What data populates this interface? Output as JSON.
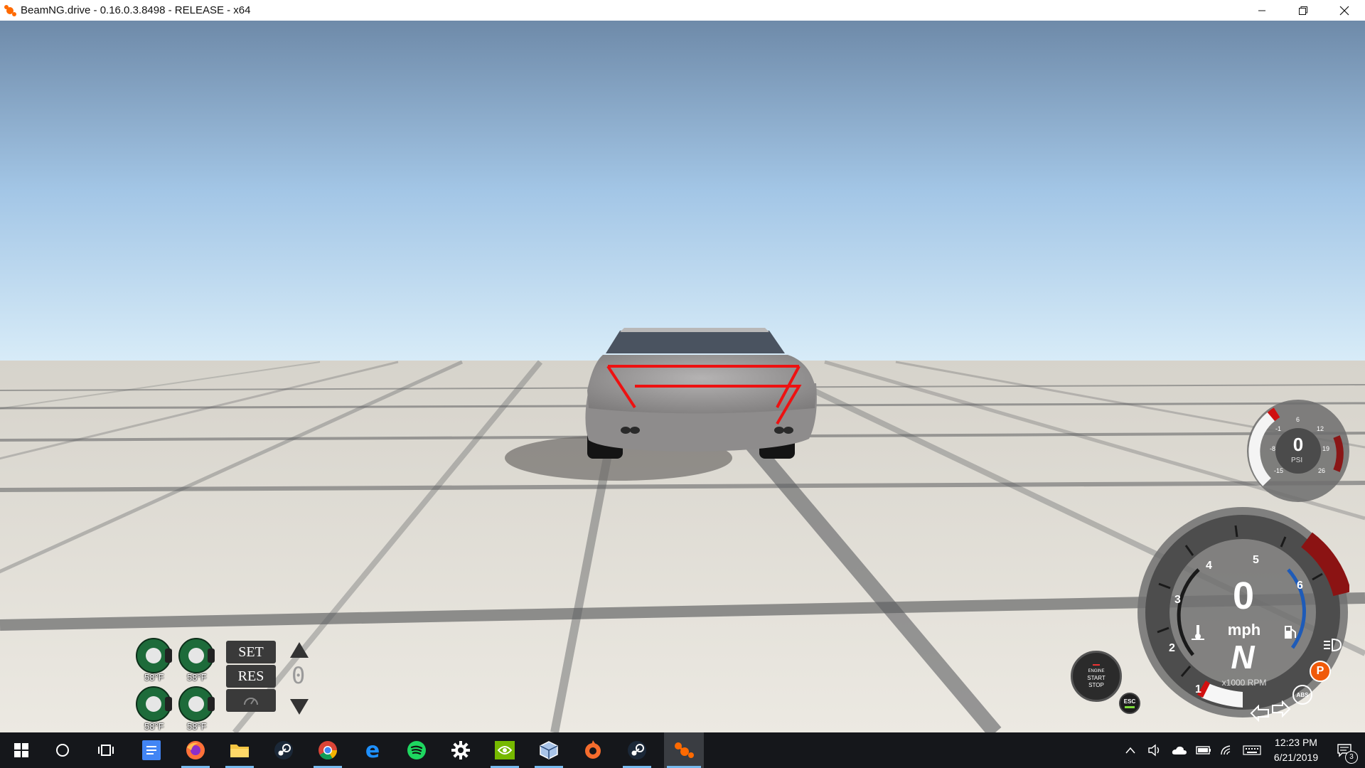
{
  "window": {
    "title": "BeamNG.drive - 0.16.0.3.8498 - RELEASE - x64",
    "minimize": "—",
    "restore": "❐",
    "close": "✕"
  },
  "hud": {
    "brake_temps": [
      "58°F",
      "58°F",
      "58°F",
      "58°F"
    ],
    "cruise": {
      "set_label": "SET",
      "res_label": "RES",
      "speed_digit": "0"
    },
    "boost_gauge": {
      "value": "0",
      "unit": "PSI",
      "ticks": [
        "6",
        "-1",
        "12",
        "-8",
        "19",
        "-15",
        "26"
      ]
    },
    "speedo": {
      "speed": "0",
      "speed_unit": "mph",
      "gear": "N",
      "rpm_label": "x1000 RPM",
      "rpm_ticks": [
        "1",
        "2",
        "3",
        "4",
        "5",
        "6"
      ]
    },
    "engine_button": {
      "line1": "ENGINE",
      "line2": "START",
      "line3": "STOP"
    },
    "esc_label": "ESC",
    "abs_label": "ABS",
    "park_label": "P"
  },
  "taskbar": {
    "apps": [
      {
        "name": "google-docs",
        "icon": "docs-icon"
      },
      {
        "name": "firefox",
        "icon": "firefox-icon"
      },
      {
        "name": "file-explorer",
        "icon": "folder-icon"
      },
      {
        "name": "steam",
        "icon": "steam-icon"
      },
      {
        "name": "chrome",
        "icon": "chrome-icon"
      },
      {
        "name": "edge",
        "icon": "edge-icon"
      },
      {
        "name": "spotify",
        "icon": "spotify-icon"
      },
      {
        "name": "settings",
        "icon": "gear-icon"
      },
      {
        "name": "nvidia",
        "icon": "nvidia-icon"
      },
      {
        "name": "virtualbox",
        "icon": "virtualbox-icon"
      },
      {
        "name": "origin",
        "icon": "origin-icon"
      },
      {
        "name": "steam-2",
        "icon": "steam-icon"
      },
      {
        "name": "beamng",
        "icon": "beamng-icon"
      }
    ],
    "time": "12:23 PM",
    "date": "6/21/2019",
    "notification_count": "3"
  }
}
